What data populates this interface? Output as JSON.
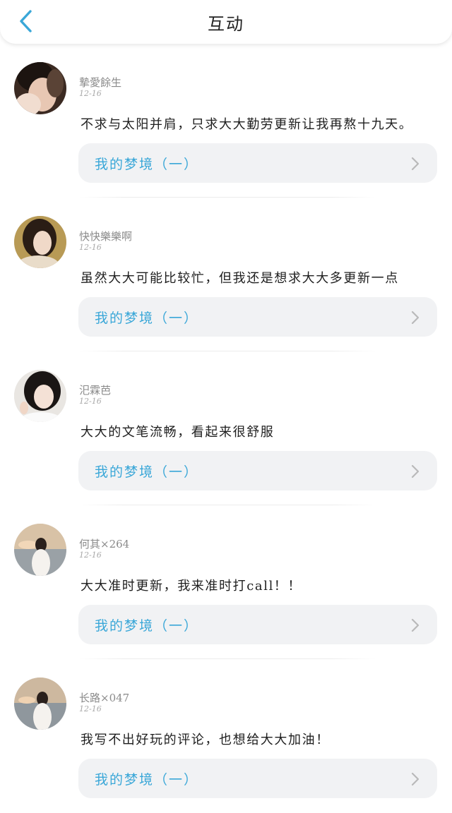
{
  "header": {
    "title": "互动",
    "back_icon": "chevron-left-icon",
    "accent": "#3aa7d8"
  },
  "comments": [
    {
      "username": "摯愛餘生",
      "date": "12-16",
      "text": "不求与太阳并肩，只求大大勤劳更新让我再熬十九天。",
      "link_label": "我的梦境（一）"
    },
    {
      "username": "快快樂樂啊",
      "date": "12-16",
      "text": "虽然大大可能比较忙，但我还是想求大大多更新一点",
      "link_label": "我的梦境（一）"
    },
    {
      "username": "汜霖芭",
      "date": "12-16",
      "text": "大大的文笔流畅，看起来很舒服",
      "link_label": "我的梦境（一）"
    },
    {
      "username": "何其×264",
      "date": "12-16",
      "text": "大大准时更新，我来准时打call！！",
      "link_label": "我的梦境（一）"
    },
    {
      "username": "长路×047",
      "date": "12-16",
      "text": "我写不出好玩的评论，也想给大大加油！",
      "link_label": "我的梦境（一）"
    }
  ]
}
